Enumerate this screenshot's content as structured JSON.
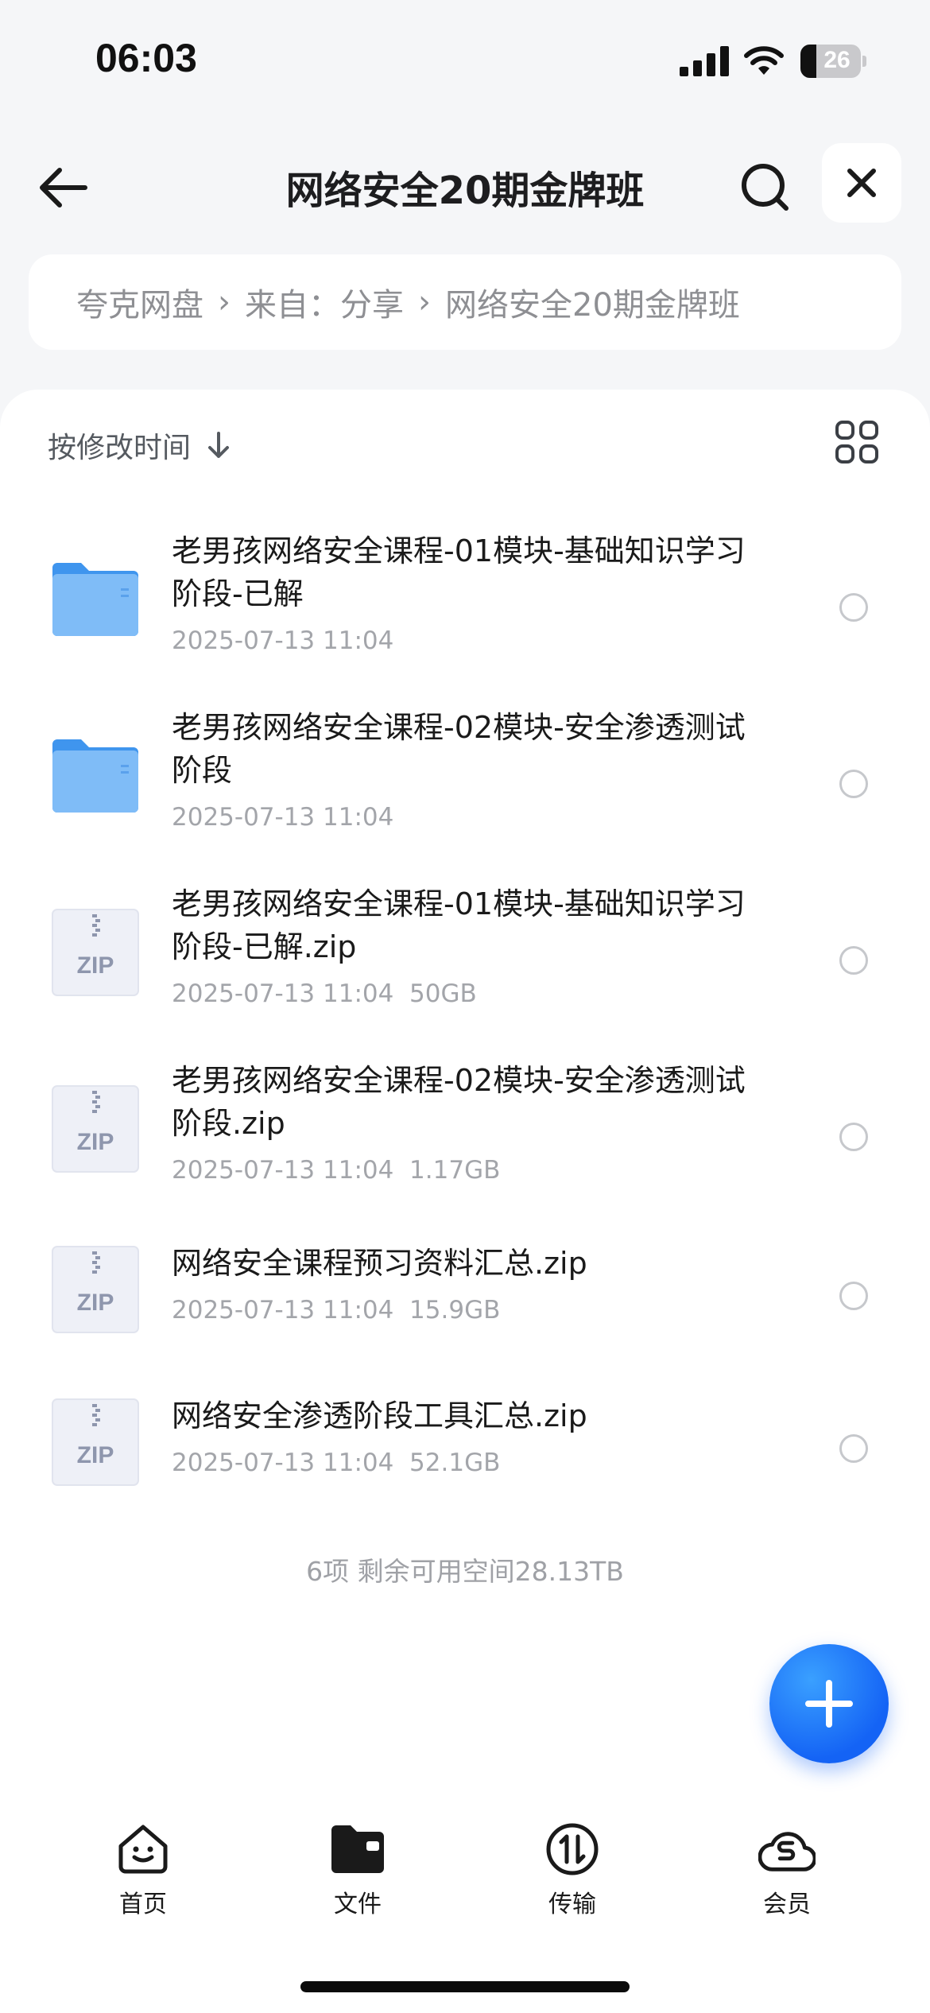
{
  "status_bar": {
    "time": "06:03",
    "battery": "26"
  },
  "header": {
    "title": "网络安全20期金牌班"
  },
  "breadcrumb": {
    "root": "夸克网盘",
    "source": "来自：分享",
    "current": "网络安全20期金牌班"
  },
  "sort": {
    "label": "按修改时间"
  },
  "files": [
    {
      "name": "老男孩网络安全课程-01模块-基础知识学习阶段-已解",
      "meta": "2025-07-13 11:04",
      "type": "folder-icon"
    },
    {
      "name": "老男孩网络安全课程-02模块-安全渗透测试阶段",
      "meta": "2025-07-13 11:04",
      "type": "folder-icon"
    },
    {
      "name": "老男孩网络安全课程-01模块-基础知识学习阶段-已解.zip",
      "meta": "2025-07-13 11:04  50GB",
      "type": "zip-icon",
      "zip_label": "ZIP"
    },
    {
      "name": "老男孩网络安全课程-02模块-安全渗透测试阶段.zip",
      "meta": "2025-07-13 11:04  1.17GB",
      "type": "zip-icon",
      "zip_label": "ZIP"
    },
    {
      "name": "网络安全课程预习资料汇总.zip",
      "meta": "2025-07-13 11:04  15.9GB",
      "type": "zip-icon",
      "zip_label": "ZIP"
    },
    {
      "name": "网络安全渗透阶段工具汇总.zip",
      "meta": "2025-07-13 11:04  52.1GB",
      "type": "zip-icon",
      "zip_label": "ZIP"
    }
  ],
  "summary": "6项 剩余可用空间28.13TB",
  "tabs": [
    {
      "label": "首页",
      "icon": "smile-face-icon"
    },
    {
      "label": "文件",
      "icon": "folder-icon"
    },
    {
      "label": "传输",
      "icon": "transfer-icon"
    },
    {
      "label": "会员",
      "icon": "cloud-member-icon"
    }
  ],
  "colors": {
    "accent": "#1463f5",
    "folder": "#5aa9f5",
    "zip_bg": "#eef0f6"
  }
}
